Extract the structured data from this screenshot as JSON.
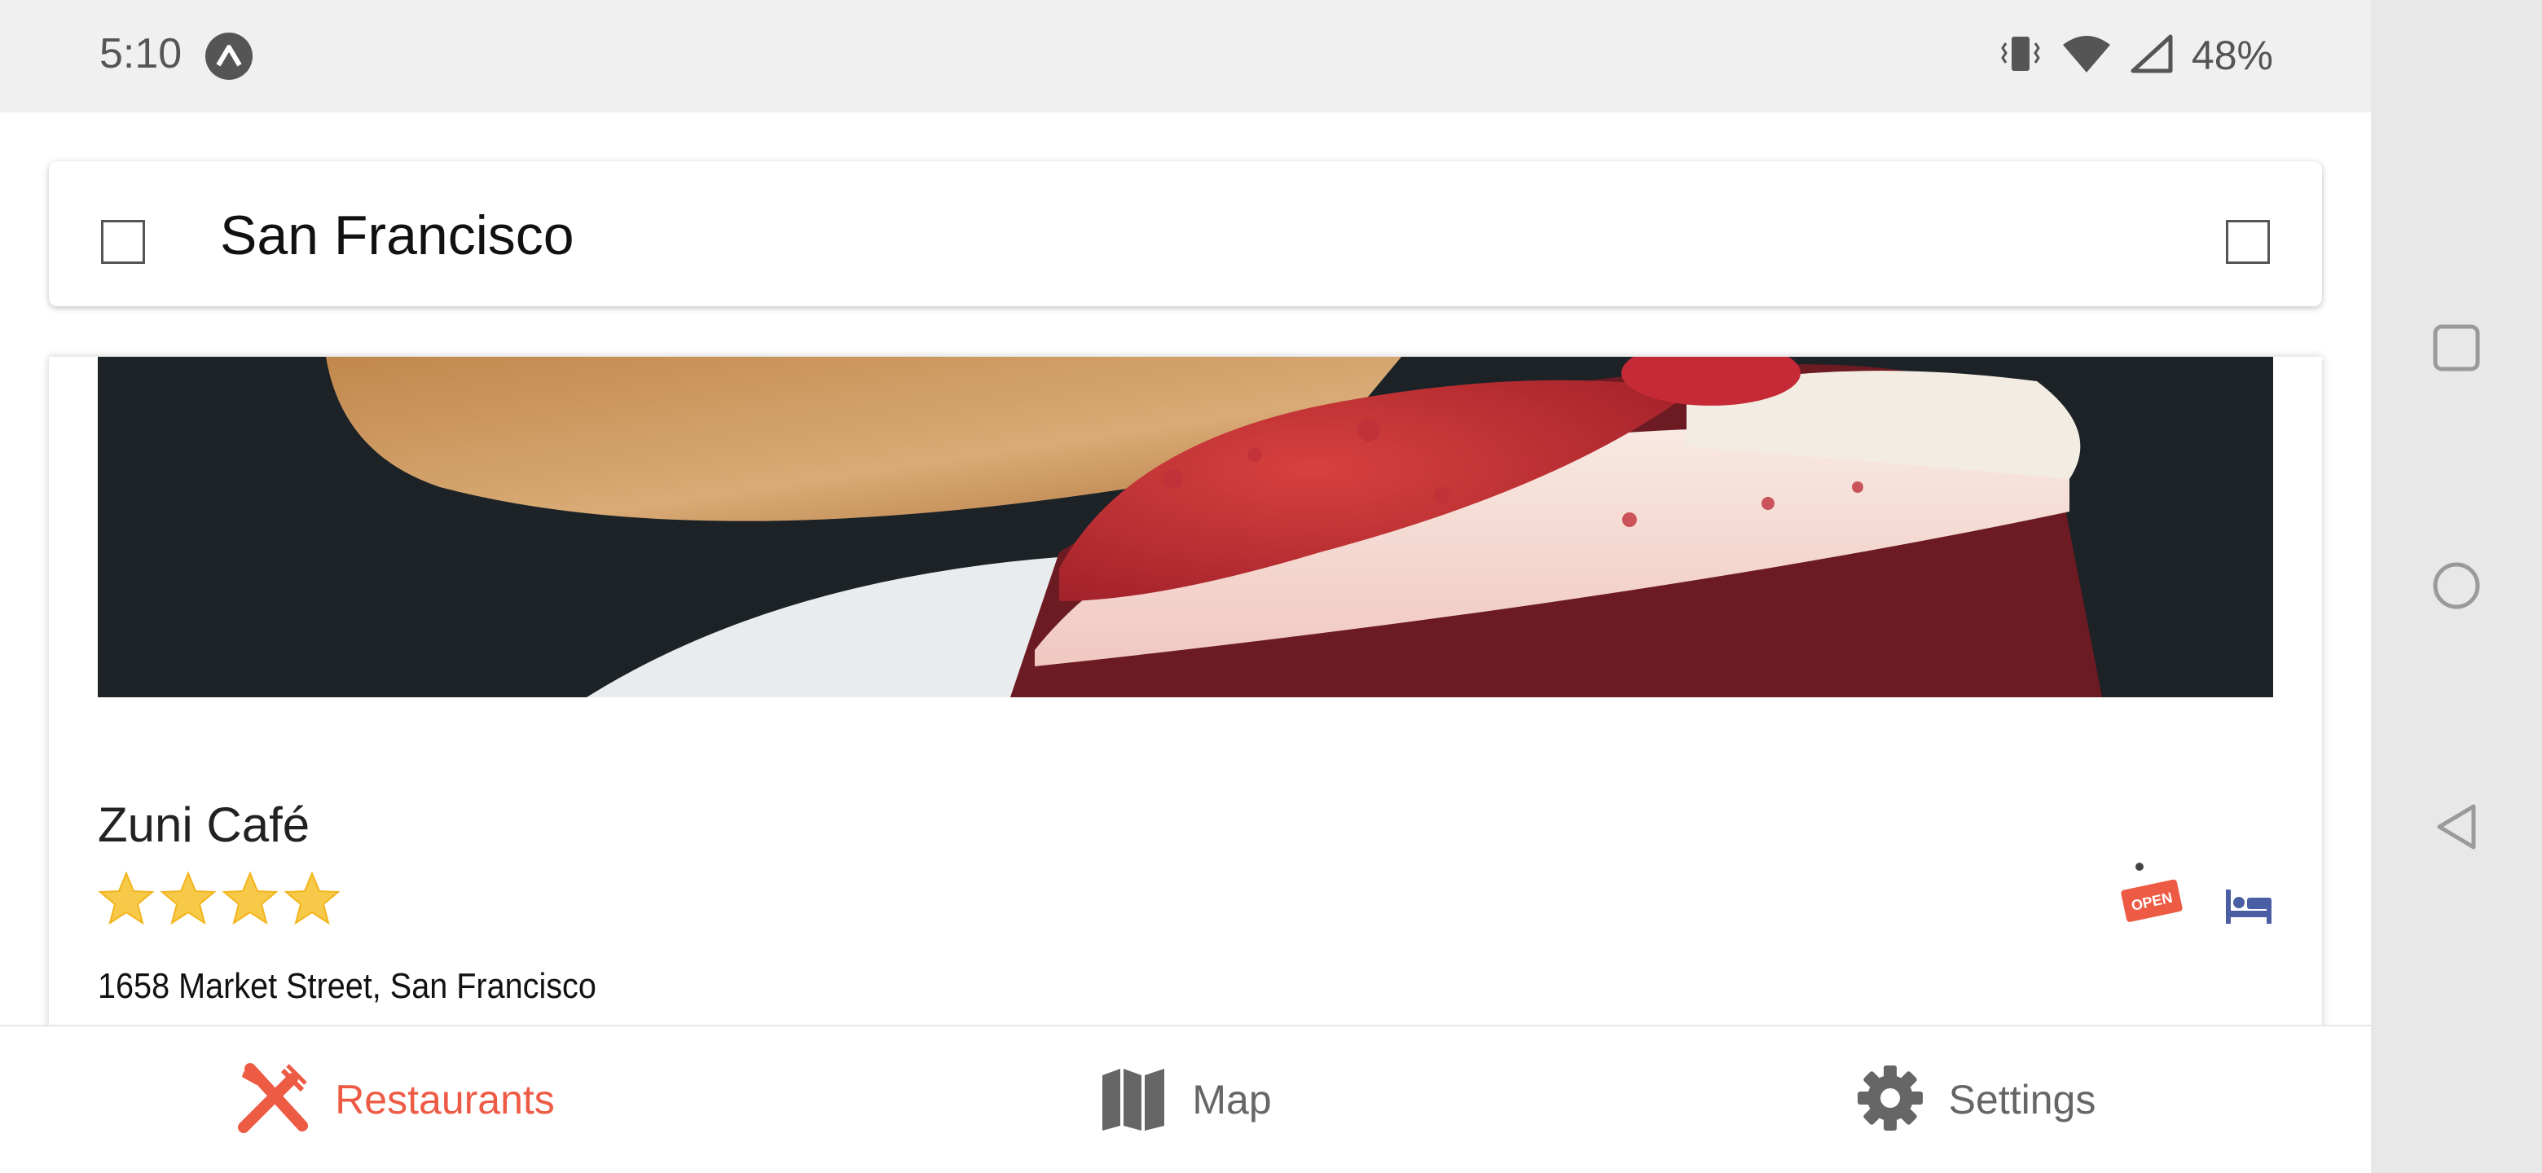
{
  "status_bar": {
    "time": "5:10",
    "battery": "48%",
    "icons": [
      "app-notification-icon",
      "vibrate-icon",
      "wifi-icon",
      "signal-icon"
    ]
  },
  "search": {
    "location": "San Francisco"
  },
  "restaurant": {
    "name": "Zuni Café",
    "rating": 4,
    "rating_max": 4,
    "address": "1658 Market Street, San Francisco",
    "badge_open": "OPEN",
    "amenity_icons": [
      "open-sign-icon",
      "bed-icon"
    ]
  },
  "bottom_nav": {
    "items": [
      {
        "label": "Restaurants",
        "icon": "fork-knife-icon",
        "active": true
      },
      {
        "label": "Map",
        "icon": "map-icon",
        "active": false
      },
      {
        "label": "Settings",
        "icon": "gear-icon",
        "active": false
      }
    ]
  },
  "colors": {
    "accent": "#ee5b45",
    "nav_inactive": "#666666",
    "bed_icon": "#4a5fa3",
    "star": "#f7c948"
  }
}
